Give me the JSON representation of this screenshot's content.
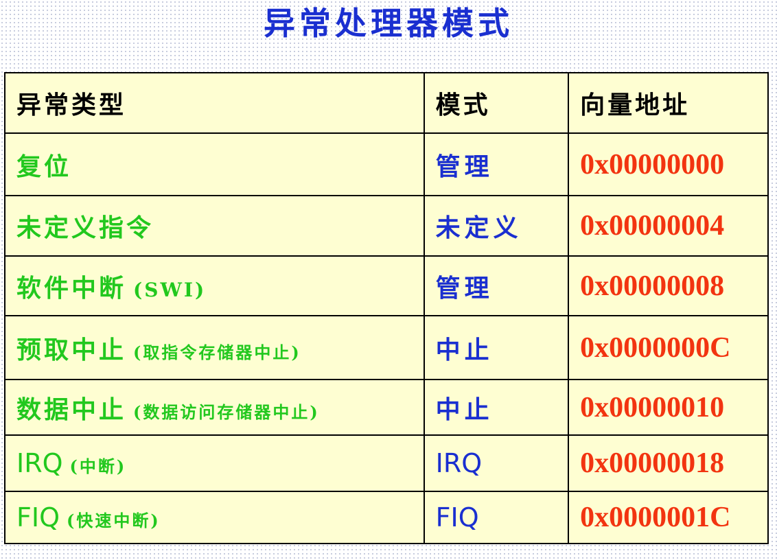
{
  "title": "异常处理器模式",
  "table": {
    "headers": {
      "type": "异常类型",
      "mode": "模式",
      "vector": "向量地址"
    },
    "rows": [
      {
        "type": "复位",
        "note": "",
        "mode": "管理",
        "vector": "0x00000000"
      },
      {
        "type": "未定义指令",
        "note": "",
        "mode": "未定义",
        "vector": "0x00000004"
      },
      {
        "type": "软件中断",
        "note": "(SWI)",
        "mode": "管理",
        "vector": "0x00000008"
      },
      {
        "type": "预取中止",
        "note": "(取指令存储器中止)",
        "mode": "中止",
        "vector": "0x0000000C"
      },
      {
        "type": "数据中止",
        "note": "(数据访问存储器中止)",
        "mode": "中止",
        "vector": "0x00000010"
      },
      {
        "type": "IRQ",
        "note": "(中断)",
        "mode": "IRQ",
        "vector": "0x00000018"
      },
      {
        "type": "FIQ",
        "note": "(快速中断)",
        "mode": "FIQ",
        "vector": "0x0000001C"
      }
    ]
  },
  "colors": {
    "title": "#1a2fd0",
    "type_text": "#22c81e",
    "mode_text": "#1a2fd0",
    "vector_text": "#f23410",
    "table_bg": "#fefed2"
  }
}
